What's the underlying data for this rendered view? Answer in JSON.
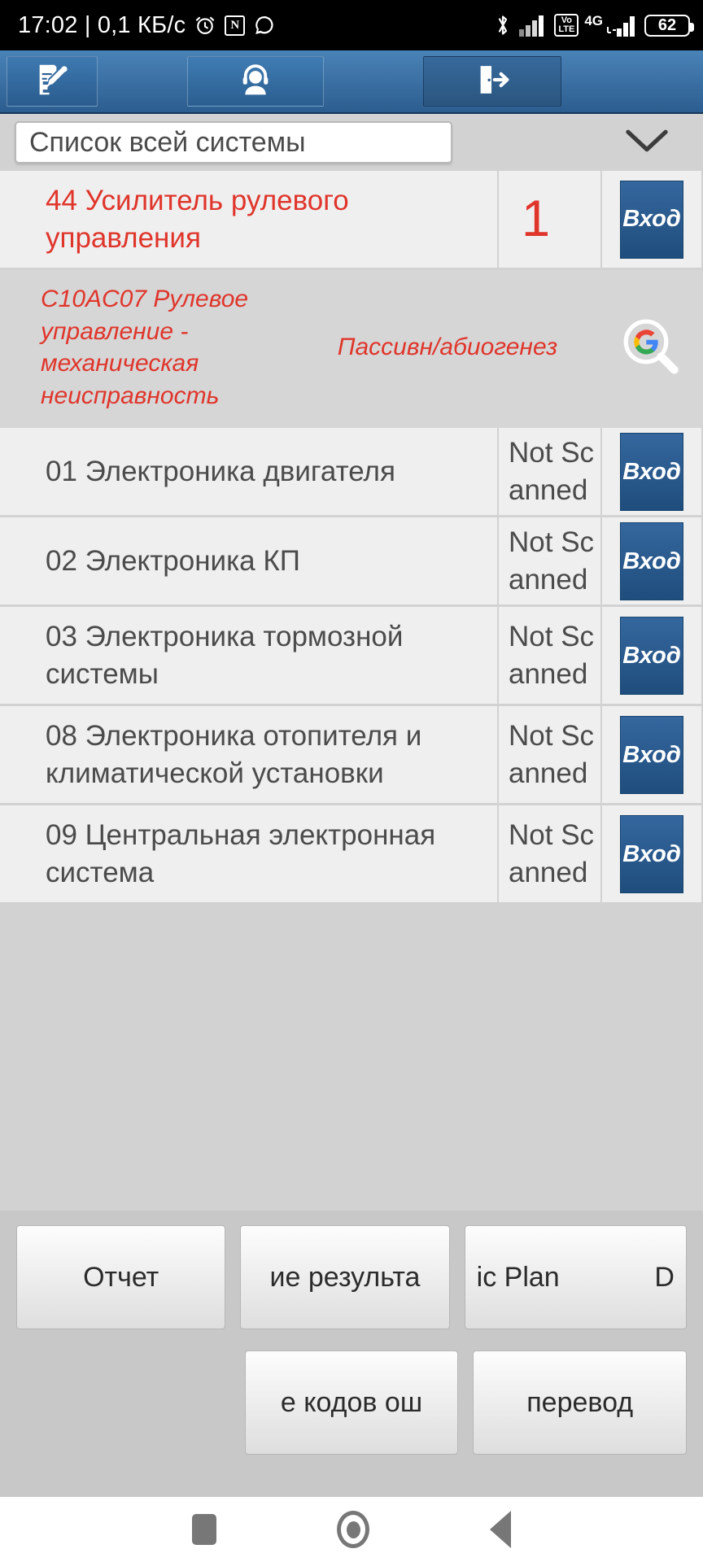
{
  "status_bar": {
    "clock": "17:02 | 0,1 КБ/с",
    "nfc_glyph": "N",
    "volte_top": "Vo",
    "volte_bottom": "LTE",
    "network": "4G",
    "battery": "62",
    "icons": [
      "alarm-clock-icon",
      "nfc-icon",
      "whatsapp-icon",
      "bluetooth-icon",
      "signal-icon",
      "volte-icon",
      "signal-icon-2",
      "battery-icon"
    ]
  },
  "toolbar": {
    "buttons": [
      {
        "name": "report-edit-button",
        "icon": "document-edit-icon"
      },
      {
        "name": "support-button",
        "icon": "headset-person-icon"
      },
      {
        "name": "exit-button",
        "icon": "exit-door-icon"
      }
    ]
  },
  "spinner": {
    "label": "Список всей системы",
    "caret": "chevron-down-icon"
  },
  "colors": {
    "accent_blue": "#2c5d8f",
    "fault_red": "#e0352b",
    "row_bg": "#efefef",
    "panel_bg": "#c8c8c8",
    "text_gray": "#4b4b4b"
  },
  "table": {
    "enter_button_label": "Вход",
    "rows": [
      {
        "name": "44 Усилитель рулевого управления",
        "status": "1",
        "fault": true,
        "button": "Вход"
      },
      {
        "name": "01 Электроника двигателя",
        "status": "Not Scanned",
        "fault": false,
        "button": "Вход"
      },
      {
        "name": "02 Электроника КП",
        "status": "Not Scanned",
        "fault": false,
        "button": "Вход"
      },
      {
        "name": "03 Электроника тормозной системы",
        "status": "Not Scanned",
        "fault": false,
        "button": "Вход"
      },
      {
        "name": "08 Электроника отопителя и климатической установки",
        "status": "Not Scanned",
        "fault": false,
        "button": "Вход"
      },
      {
        "name": "09 Центральная электронная система",
        "status": "Not Scanned",
        "fault": false,
        "button": "Вход"
      }
    ]
  },
  "dtc": {
    "code_text": "C10AC07 Рулевое управление - механическая неисправность",
    "state": "Пассивн/абиогенез",
    "search_icon": "google-search-icon"
  },
  "bottom_buttons": {
    "row1": [
      {
        "label": "Отчет",
        "name": "report-button"
      },
      {
        "label": "ие результа",
        "name": "save-results-button"
      },
      {
        "label": "ic Plan",
        "label2": "D",
        "name": "diagnostic-plan-button"
      }
    ],
    "row2": [
      {
        "label": "е кодов ош",
        "name": "clear-fault-codes-button"
      },
      {
        "label": "перевод",
        "name": "translate-button"
      }
    ]
  },
  "navbar": {
    "recents": "recents-square-icon",
    "home": "home-circle-icon",
    "back": "back-triangle-icon"
  }
}
